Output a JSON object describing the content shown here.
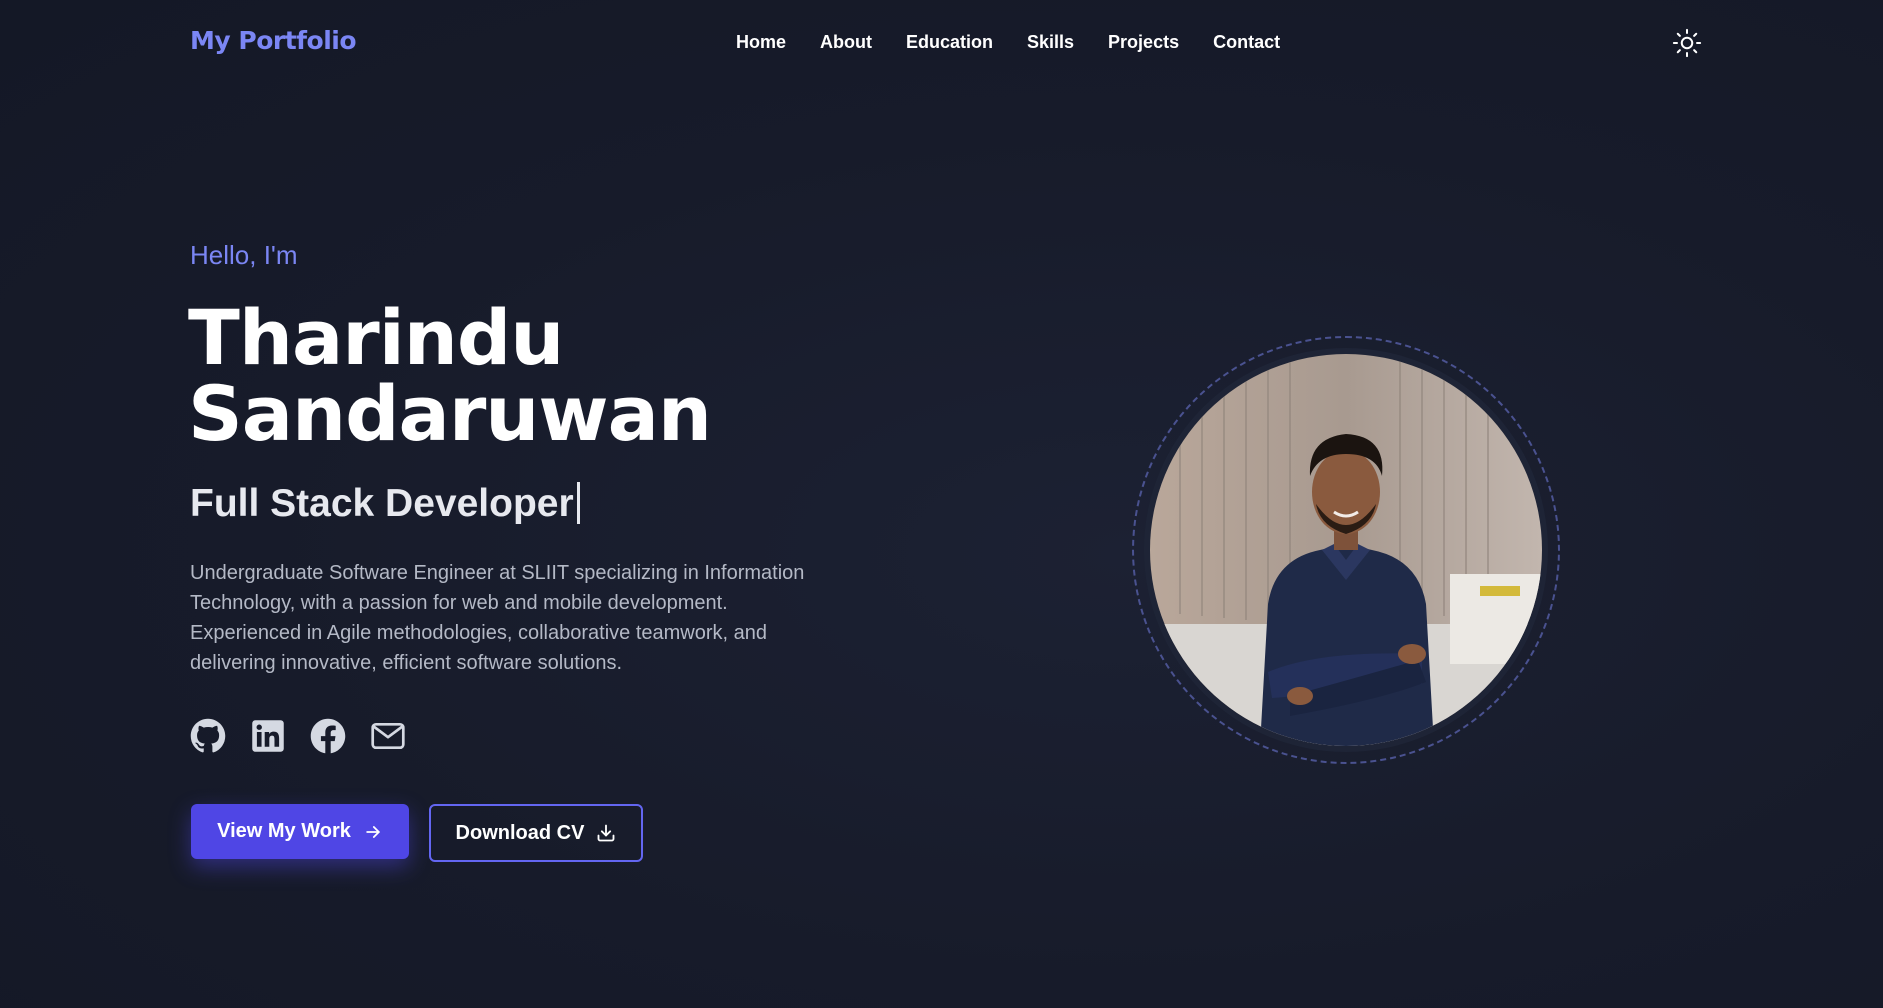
{
  "header": {
    "logo": "My Portfolio",
    "nav": [
      "Home",
      "About",
      "Education",
      "Skills",
      "Projects",
      "Contact"
    ],
    "theme_icon": "sun-icon"
  },
  "hero": {
    "greeting": "Hello, I'm",
    "name_line1": "Tharindu",
    "name_line2": "Sandaruwan",
    "role": "Full Stack Developer",
    "bio": "Undergraduate Software Engineer at SLIIT specializing in Information Technology, with a passion for web and mobile development. Experienced in Agile methodologies, collaborative teamwork, and delivering innovative, efficient software solutions.",
    "socials": [
      "github-icon",
      "linkedin-icon",
      "facebook-icon",
      "mail-icon"
    ],
    "primary_button": "View My Work",
    "secondary_button": "Download CV"
  },
  "colors": {
    "accent": "#7b86f4",
    "button": "#4f46e5",
    "background": "#171b2a",
    "body_text": "#b4b9c6"
  }
}
